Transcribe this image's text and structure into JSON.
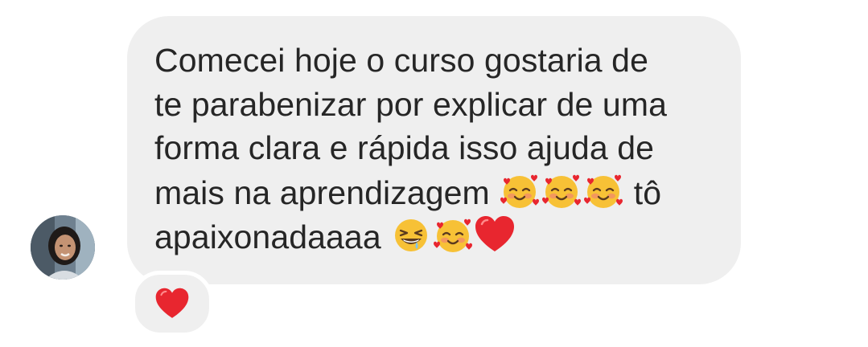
{
  "message": {
    "lines": [
      "Comecei hoje o curso gostaria de",
      "te parabenizar por explicar de uma",
      "forma clara e rápida isso ajuda de",
      "mais na aprendizagem",
      "tô",
      "apaixonadaaaa"
    ]
  },
  "emojis": {
    "line4": [
      "smiling-face-with-hearts",
      "smiling-face-with-hearts",
      "smiling-face-with-hearts"
    ],
    "line5": [
      "grinning-squinting-face",
      "smiling-face-with-hearts",
      "red-heart"
    ]
  },
  "reaction": {
    "emoji": "red-heart"
  },
  "colors": {
    "bubble": "#efefef",
    "text": "#262626",
    "heart": "#e8262f"
  }
}
